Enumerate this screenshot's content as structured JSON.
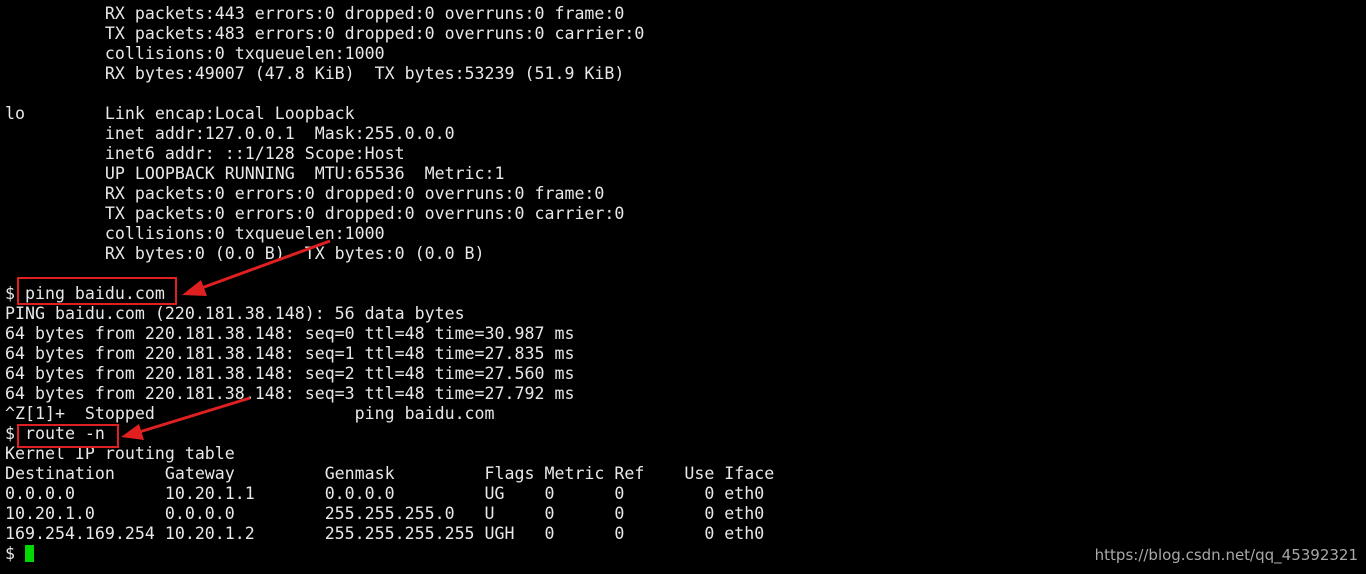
{
  "terminal": {
    "lines": [
      "          RX packets:443 errors:0 dropped:0 overruns:0 frame:0",
      "          TX packets:483 errors:0 dropped:0 overruns:0 carrier:0",
      "          collisions:0 txqueuelen:1000",
      "          RX bytes:49007 (47.8 KiB)  TX bytes:53239 (51.9 KiB)",
      "",
      "lo        Link encap:Local Loopback",
      "          inet addr:127.0.0.1  Mask:255.0.0.0",
      "          inet6 addr: ::1/128 Scope:Host",
      "          UP LOOPBACK RUNNING  MTU:65536  Metric:1",
      "          RX packets:0 errors:0 dropped:0 overruns:0 frame:0",
      "          TX packets:0 errors:0 dropped:0 overruns:0 carrier:0",
      "          collisions:0 txqueuelen:1000",
      "          RX bytes:0 (0.0 B)  TX bytes:0 (0.0 B)",
      "",
      "$ ping baidu.com",
      "PING baidu.com (220.181.38.148): 56 data bytes",
      "64 bytes from 220.181.38.148: seq=0 ttl=48 time=30.987 ms",
      "64 bytes from 220.181.38.148: seq=1 ttl=48 time=27.835 ms",
      "64 bytes from 220.181.38.148: seq=2 ttl=48 time=27.560 ms",
      "64 bytes from 220.181.38.148: seq=3 ttl=48 time=27.792 ms",
      "^Z[1]+  Stopped                    ping baidu.com",
      "$ route -n",
      "Kernel IP routing table",
      "Destination     Gateway         Genmask         Flags Metric Ref    Use Iface",
      "0.0.0.0         10.20.1.1       0.0.0.0         UG    0      0        0 eth0",
      "10.20.1.0       0.0.0.0         255.255.255.0   U     0      0        0 eth0",
      "169.254.169.254 10.20.1.2       255.255.255.255 UGH   0      0        0 eth0"
    ],
    "prompt": "$ ",
    "cursor_color": "#00d800"
  },
  "annotations": {
    "color": "#e02020"
  },
  "watermark": "https://blog.csdn.net/qq_45392321"
}
